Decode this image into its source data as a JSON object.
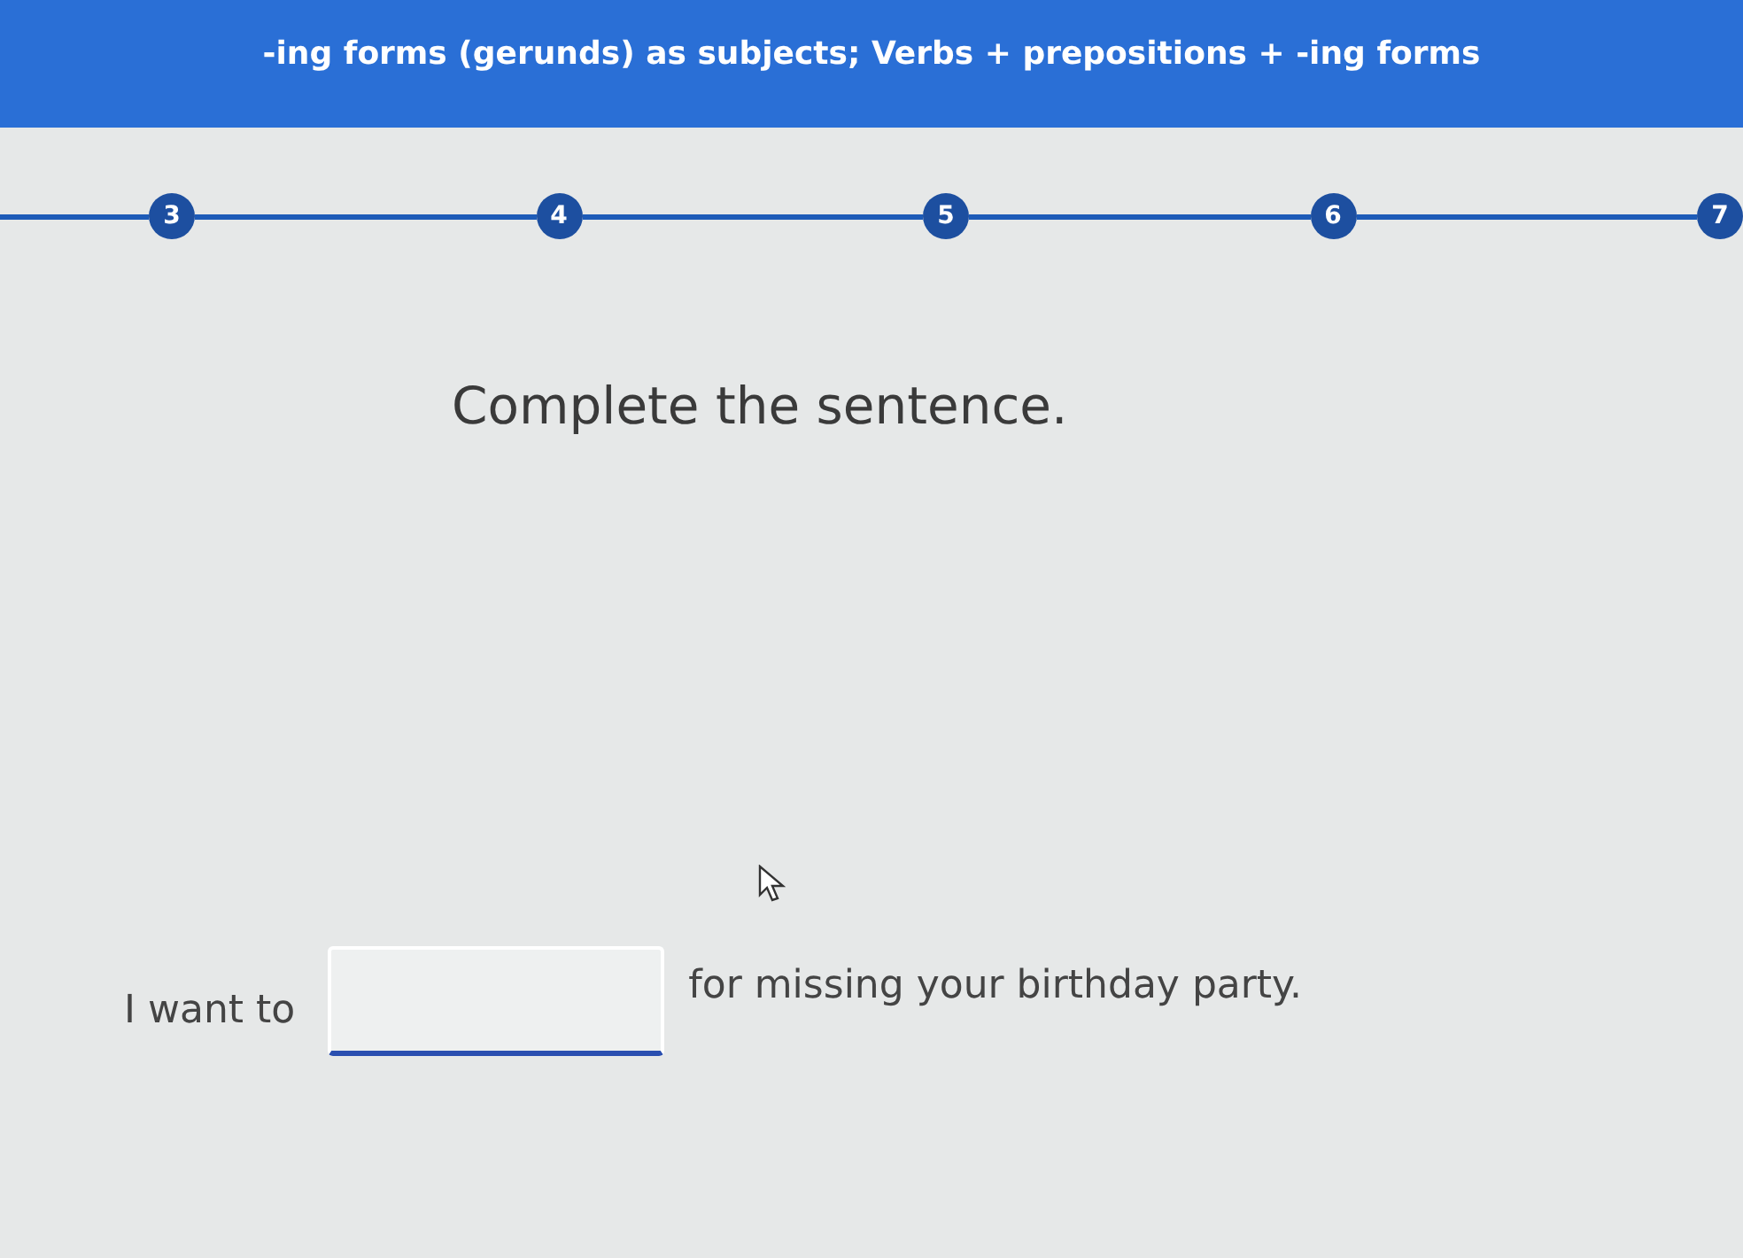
{
  "header": {
    "title": "-ing forms (gerunds) as subjects; Verbs + prepositions + -ing forms"
  },
  "steps": [
    {
      "label": "3"
    },
    {
      "label": "4"
    },
    {
      "label": "5"
    },
    {
      "label": "6"
    },
    {
      "label": "7"
    }
  ],
  "prompt": "Complete the sentence.",
  "sentence": {
    "before": "I want to",
    "after": "for missing your birthday party."
  }
}
